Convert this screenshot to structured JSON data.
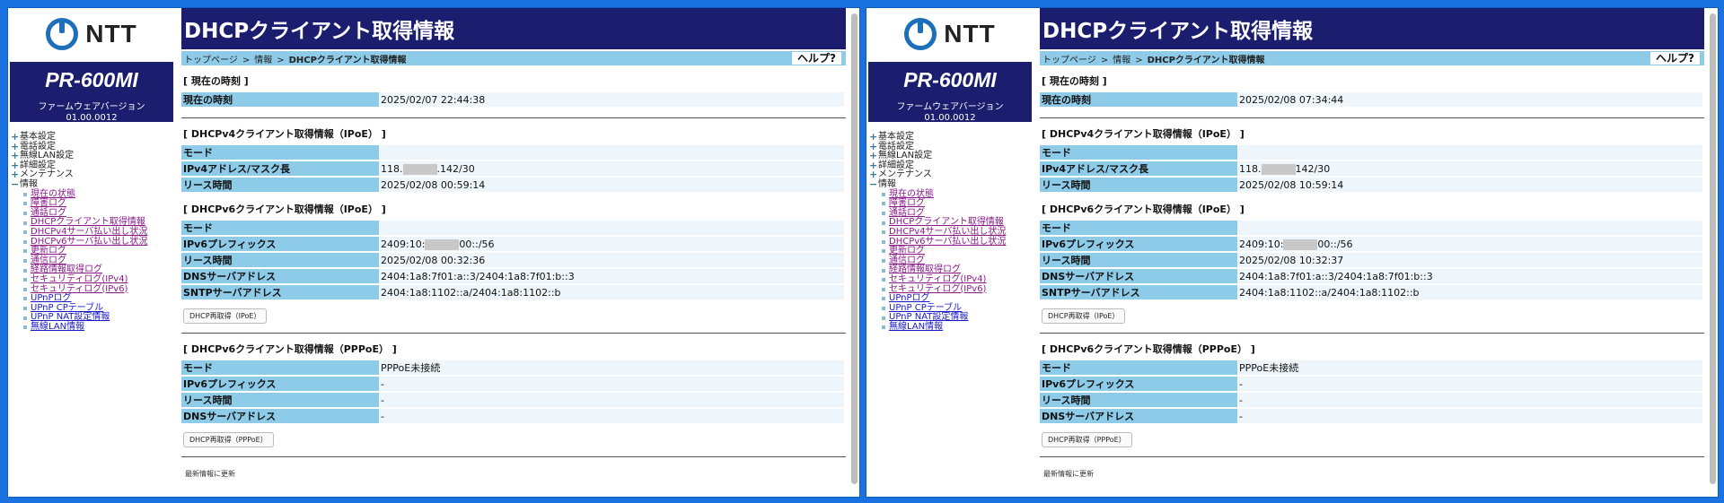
{
  "windows": [
    {
      "logo": {
        "text": "NTT"
      },
      "model": {
        "name": "PR-600MI",
        "fw_label": "ファームウェアバージョン",
        "fw_version": "01.00.0012"
      },
      "menu": {
        "top": [
          "基本設定",
          "電話設定",
          "無線LAN設定",
          "詳細設定",
          "メンテナンス",
          "情報"
        ],
        "info_sub": [
          {
            "label": "現在の状態",
            "visited": true
          },
          {
            "label": "障害ログ",
            "visited": true
          },
          {
            "label": "通話ログ",
            "visited": true
          },
          {
            "label": "DHCPクライアント取得情報",
            "visited": true
          },
          {
            "label": "DHCPv4サーバ払い出し状況",
            "visited": true
          },
          {
            "label": "DHCPv6サーバ払い出し状況",
            "visited": true
          },
          {
            "label": "更新ログ",
            "visited": true
          },
          {
            "label": "通信ログ",
            "visited": true
          },
          {
            "label": "経路情報取得ログ",
            "visited": true
          },
          {
            "label": "セキュリティログ(IPv4)",
            "visited": true
          },
          {
            "label": "セキュリティログ(IPv6)",
            "visited": true
          },
          {
            "label": "UPnPログ",
            "visited": false
          },
          {
            "label": "UPnP CPテーブル",
            "visited": false
          },
          {
            "label": "UPnP NAT設定情報",
            "visited": false
          },
          {
            "label": "無線LAN情報",
            "visited": false
          }
        ]
      },
      "header": {
        "title": "DHCPクライアント取得情報",
        "help": "ヘルプ?"
      },
      "breadcrumb": {
        "items": [
          "トップページ",
          "情報",
          "DHCPクライアント取得情報"
        ]
      },
      "current_time": {
        "title": "[ 現在の時刻 ]",
        "label": "現在の時刻",
        "value": "2025/02/07 22:44:38"
      },
      "ipv4": {
        "title": "[ DHCPv4クライアント取得情報（IPoE） ]",
        "mode_label": "モード",
        "mode_value": "",
        "addr_label": "IPv4アドレス/マスク長",
        "addr_prefix": "118.",
        "addr_suffix": ".142/30",
        "lease_label": "リース時間",
        "lease_value": "2025/02/08 00:59:14"
      },
      "ipv6": {
        "title": "[ DHCPv6クライアント取得情報（IPoE） ]",
        "mode_label": "モード",
        "mode_value": "",
        "prefix_label": "IPv6プレフィックス",
        "prefix_start": "2409:10:",
        "prefix_end": "00::/56",
        "lease_label": "リース時間",
        "lease_value": "2025/02/08 00:32:36",
        "dns_label": "DNSサーバアドレス",
        "dns_value": "2404:1a8:7f01:a::3/2404:1a8:7f01:b::3",
        "sntp_label": "SNTPサーバアドレス",
        "sntp_value": "2404:1a8:1102::a/2404:1a8:1102::b",
        "button": "DHCP再取得（IPoE）"
      },
      "pppoe": {
        "title": "[ DHCPv6クライアント取得情報（PPPoE） ]",
        "mode_label": "モード",
        "mode_value": "PPPoE未接続",
        "prefix_label": "IPv6プレフィックス",
        "prefix_value": "-",
        "lease_label": "リース時間",
        "lease_value": "-",
        "dns_label": "DNSサーバアドレス",
        "dns_value": "-",
        "button": "DHCP再取得（PPPoE）"
      },
      "footer": {
        "refresh": "最新情報に更新"
      }
    },
    {
      "logo": {
        "text": "NTT"
      },
      "model": {
        "name": "PR-600MI",
        "fw_label": "ファームウェアバージョン",
        "fw_version": "01.00.0012"
      },
      "menu": {
        "top": [
          "基本設定",
          "電話設定",
          "無線LAN設定",
          "詳細設定",
          "メンテナンス",
          "情報"
        ],
        "info_sub": [
          {
            "label": "現在の状態",
            "visited": true
          },
          {
            "label": "障害ログ",
            "visited": true
          },
          {
            "label": "通話ログ",
            "visited": true
          },
          {
            "label": "DHCPクライアント取得情報",
            "visited": true
          },
          {
            "label": "DHCPv4サーバ払い出し状況",
            "visited": true
          },
          {
            "label": "DHCPv6サーバ払い出し状況",
            "visited": true
          },
          {
            "label": "更新ログ",
            "visited": true
          },
          {
            "label": "通信ログ",
            "visited": true
          },
          {
            "label": "経路情報取得ログ",
            "visited": true
          },
          {
            "label": "セキュリティログ(IPv4)",
            "visited": true
          },
          {
            "label": "セキュリティログ(IPv6)",
            "visited": true
          },
          {
            "label": "UPnPログ",
            "visited": false
          },
          {
            "label": "UPnP CPテーブル",
            "visited": false
          },
          {
            "label": "UPnP NAT設定情報",
            "visited": false
          },
          {
            "label": "無線LAN情報",
            "visited": false
          }
        ]
      },
      "header": {
        "title": "DHCPクライアント取得情報",
        "help": "ヘルプ?"
      },
      "breadcrumb": {
        "items": [
          "トップページ",
          "情報",
          "DHCPクライアント取得情報"
        ]
      },
      "current_time": {
        "title": "[ 現在の時刻 ]",
        "label": "現在の時刻",
        "value": "2025/02/08 07:34:44"
      },
      "ipv4": {
        "title": "[ DHCPv4クライアント取得情報（IPoE） ]",
        "mode_label": "モード",
        "mode_value": "",
        "addr_label": "IPv4アドレス/マスク長",
        "addr_prefix": "118.",
        "addr_suffix": "142/30",
        "lease_label": "リース時間",
        "lease_value": "2025/02/08 10:59:14"
      },
      "ipv6": {
        "title": "[ DHCPv6クライアント取得情報（IPoE） ]",
        "mode_label": "モード",
        "mode_value": "",
        "prefix_label": "IPv6プレフィックス",
        "prefix_start": "2409:10:",
        "prefix_end": "00::/56",
        "lease_label": "リース時間",
        "lease_value": "2025/02/08 10:32:37",
        "dns_label": "DNSサーバアドレス",
        "dns_value": "2404:1a8:7f01:a::3/2404:1a8:7f01:b::3",
        "sntp_label": "SNTPサーバアドレス",
        "sntp_value": "2404:1a8:1102::a/2404:1a8:1102::b",
        "button": "DHCP再取得（IPoE）"
      },
      "pppoe": {
        "title": "[ DHCPv6クライアント取得情報（PPPoE） ]",
        "mode_label": "モード",
        "mode_value": "PPPoE未接続",
        "prefix_label": "IPv6プレフィックス",
        "prefix_value": "-",
        "lease_label": "リース時間",
        "lease_value": "-",
        "dns_label": "DNSサーバアドレス",
        "dns_value": "-",
        "button": "DHCP再取得（PPPoE）"
      },
      "footer": {
        "refresh": "最新情報に更新"
      }
    }
  ]
}
